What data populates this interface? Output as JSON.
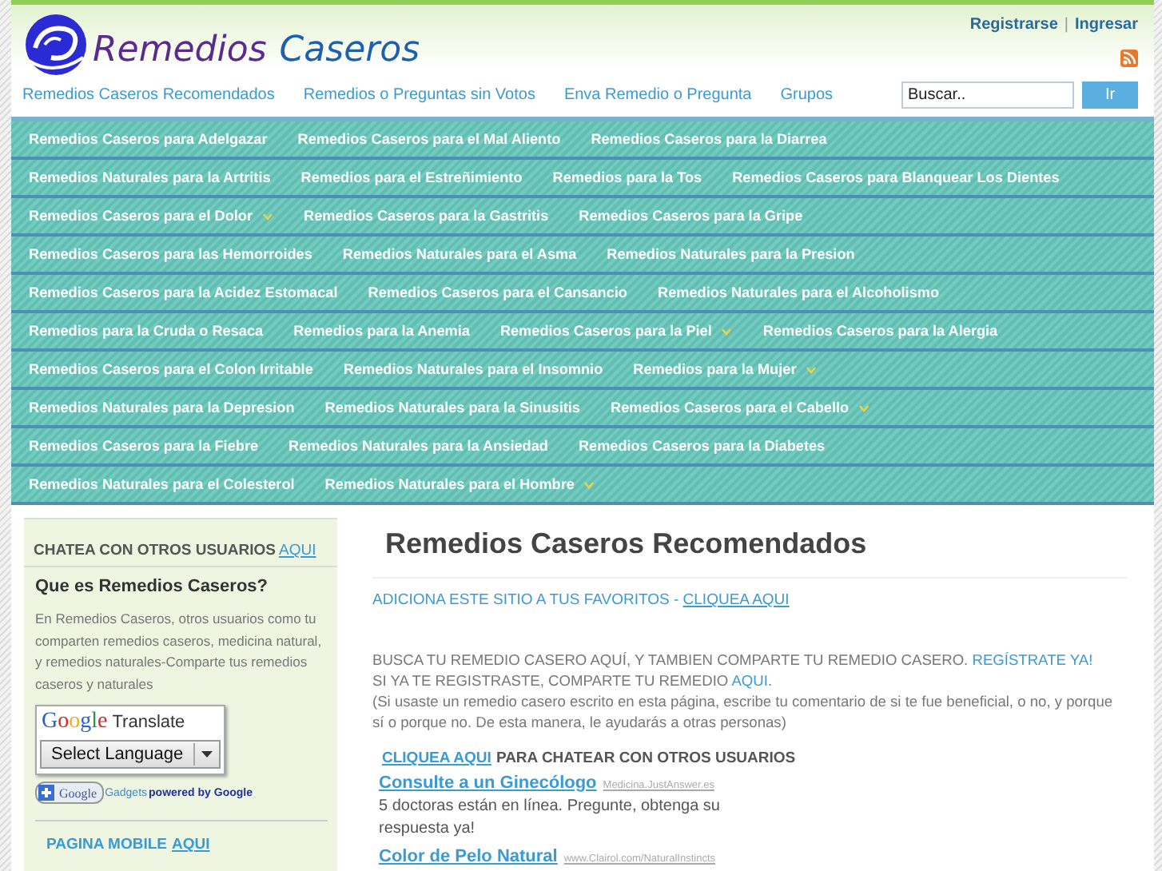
{
  "header": {
    "logo": {
      "words": [
        "Remedios",
        "Caseros"
      ]
    },
    "account_links": [
      "Registrarse",
      "Ingresar"
    ],
    "separator": "|"
  },
  "nav": [
    "Remedios Caseros Recomendados",
    "Remedios o Preguntas sin Votos",
    "Enva Remedio o Pregunta",
    "Grupos"
  ],
  "search": {
    "placeholder": "Buscar..",
    "button": "Ir"
  },
  "menu_rows": [
    [
      {
        "label": "Remedios Caseros para Adelgazar",
        "has_submenu": false
      },
      {
        "label": "Remedios Caseros para el Mal Aliento",
        "has_submenu": false
      },
      {
        "label": "Remedios Caseros para la Diarrea",
        "has_submenu": false
      }
    ],
    [
      {
        "label": "Remedios Naturales para la Artritis",
        "has_submenu": false
      },
      {
        "label": "Remedios para el Estreñimiento",
        "has_submenu": false
      },
      {
        "label": "Remedios para la Tos",
        "has_submenu": false
      },
      {
        "label": "Remedios Caseros para Blanquear Los Dientes",
        "has_submenu": false
      }
    ],
    [
      {
        "label": "Remedios Caseros para el Dolor",
        "has_submenu": true
      },
      {
        "label": "Remedios Caseros para la Gastritis",
        "has_submenu": false
      },
      {
        "label": "Remedios Caseros para la Gripe",
        "has_submenu": false
      }
    ],
    [
      {
        "label": "Remedios Caseros para las Hemorroides",
        "has_submenu": false
      },
      {
        "label": "Remedios Naturales para el Asma",
        "has_submenu": false
      },
      {
        "label": "Remedios Naturales para la Presion",
        "has_submenu": false
      }
    ],
    [
      {
        "label": "Remedios Caseros para la Acidez Estomacal",
        "has_submenu": false
      },
      {
        "label": "Remedios Caseros para el Cansancio",
        "has_submenu": false
      },
      {
        "label": "Remedios Naturales para el Alcoholismo",
        "has_submenu": false
      }
    ],
    [
      {
        "label": "Remedios para la Cruda o Resaca",
        "has_submenu": false
      },
      {
        "label": "Remedios para la Anemia",
        "has_submenu": false
      },
      {
        "label": "Remedios Caseros para la Piel",
        "has_submenu": true
      },
      {
        "label": "Remedios Caseros para la Alergia",
        "has_submenu": false
      }
    ],
    [
      {
        "label": "Remedios Caseros para el Colon Irritable",
        "has_submenu": false
      },
      {
        "label": "Remedios Naturales para el Insomnio",
        "has_submenu": false
      },
      {
        "label": "Remedios para la Mujer",
        "has_submenu": true
      }
    ],
    [
      {
        "label": "Remedios Naturales para la Depresion",
        "has_submenu": false
      },
      {
        "label": "Remedios Naturales para la Sinusitis",
        "has_submenu": false
      },
      {
        "label": "Remedios Caseros para el Cabello",
        "has_submenu": true
      }
    ],
    [
      {
        "label": "Remedios Caseros para la Fiebre",
        "has_submenu": false
      },
      {
        "label": "Remedios Naturales para la Ansiedad",
        "has_submenu": false
      },
      {
        "label": "Remedios Caseros para la Diabetes",
        "has_submenu": false
      }
    ],
    [
      {
        "label": "Remedios Naturales para el Colesterol",
        "has_submenu": false
      },
      {
        "label": "Remedios Naturales para el Hombre",
        "has_submenu": true
      }
    ]
  ],
  "sidebar": {
    "chat": {
      "text": "CHATEA CON OTROS USUARIOS",
      "link": "AQUI"
    },
    "about": {
      "title": "Que es Remedios Caseros?",
      "text": "En Remedios Caseros, otros usuarios como tu comparten remedios caseros, medicina natural, y remedios naturales-Comparte tus remedios caseros y naturales"
    },
    "translate": {
      "brand": "Google",
      "label": "Translate",
      "select": "Select Language"
    },
    "gadgets": {
      "badge": "Google",
      "link": "Gadgets",
      "powered": "powered by Google"
    },
    "mobile": {
      "text": "PAGINA MOBILE",
      "link": "AQUI"
    }
  },
  "main": {
    "title": "Remedios Caseros Recomendados",
    "favorites": {
      "text": "ADICIONA ESTE SITIO A TUS FAVORITOS - ",
      "link": "CLIQUEA AQUI"
    },
    "intro": [
      [
        {
          "text": "BUSCA TU REMEDIO CASERO AQUÍ, Y TAMBIEN COMPARTE TU REMEDIO CASERO. ",
          "link": false
        },
        {
          "text": "REGÍSTRATE YA!",
          "link": true
        }
      ],
      [
        {
          "text": "SI YA TE REGISTRASTE, COMPARTE TU REMEDIO ",
          "link": false
        },
        {
          "text": "AQUI",
          "link": true
        },
        {
          "text": ".",
          "link": false
        }
      ],
      [
        {
          "text": "(Si usaste un remedio casero escrito en esta página, escribe tu comentario de si te fue beneficial, o no, y porque sí o porque no. De esta manera, le ayudarás a otras personas)",
          "link": false
        }
      ]
    ],
    "chat": {
      "link": "CLIQUEA AQUI",
      "text": "PARA CHATEAR CON OTROS USUARIOS"
    },
    "ads": [
      {
        "title": "Consulte a un Ginecólogo",
        "url": "Medicina.JustAnswer.es",
        "text": "5 doctoras están en línea. Pregunte, obtenga su respuesta ya!"
      },
      {
        "title": "Color de Pelo Natural",
        "url": "www.Clairol.com/NaturalInstincts"
      }
    ]
  }
}
